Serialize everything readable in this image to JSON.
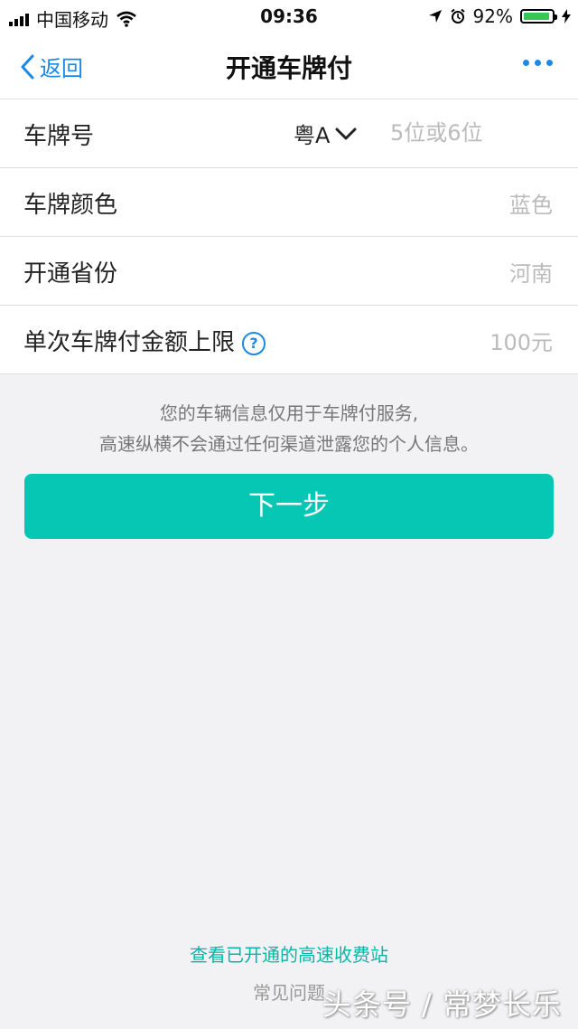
{
  "status_bar": {
    "carrier": "中国移动",
    "time": "09:36",
    "battery": "92%",
    "battery_level": 0.92
  },
  "nav": {
    "back_label": "返回",
    "title": "开通车牌付"
  },
  "form": {
    "plate_number": {
      "label": "车牌号",
      "prefix": "粤A",
      "placeholder": "5位或6位"
    },
    "plate_color": {
      "label": "车牌颜色",
      "value": "蓝色"
    },
    "province": {
      "label": "开通省份",
      "value": "河南"
    },
    "limit": {
      "label": "单次车牌付金额上限",
      "value": "100元",
      "help": "?"
    }
  },
  "notice": {
    "line1": "您的车辆信息仅用于车牌付服务,",
    "line2": "高速纵横不会通过任何渠道泄露您的个人信息。"
  },
  "next_button": "下一步",
  "links": {
    "stations": "查看已开通的高速收费站",
    "faq": "常见问题"
  },
  "watermark": "头条号 / 常梦长乐",
  "colors": {
    "accent": "#05c7b4",
    "link_blue": "#1e88e5"
  }
}
